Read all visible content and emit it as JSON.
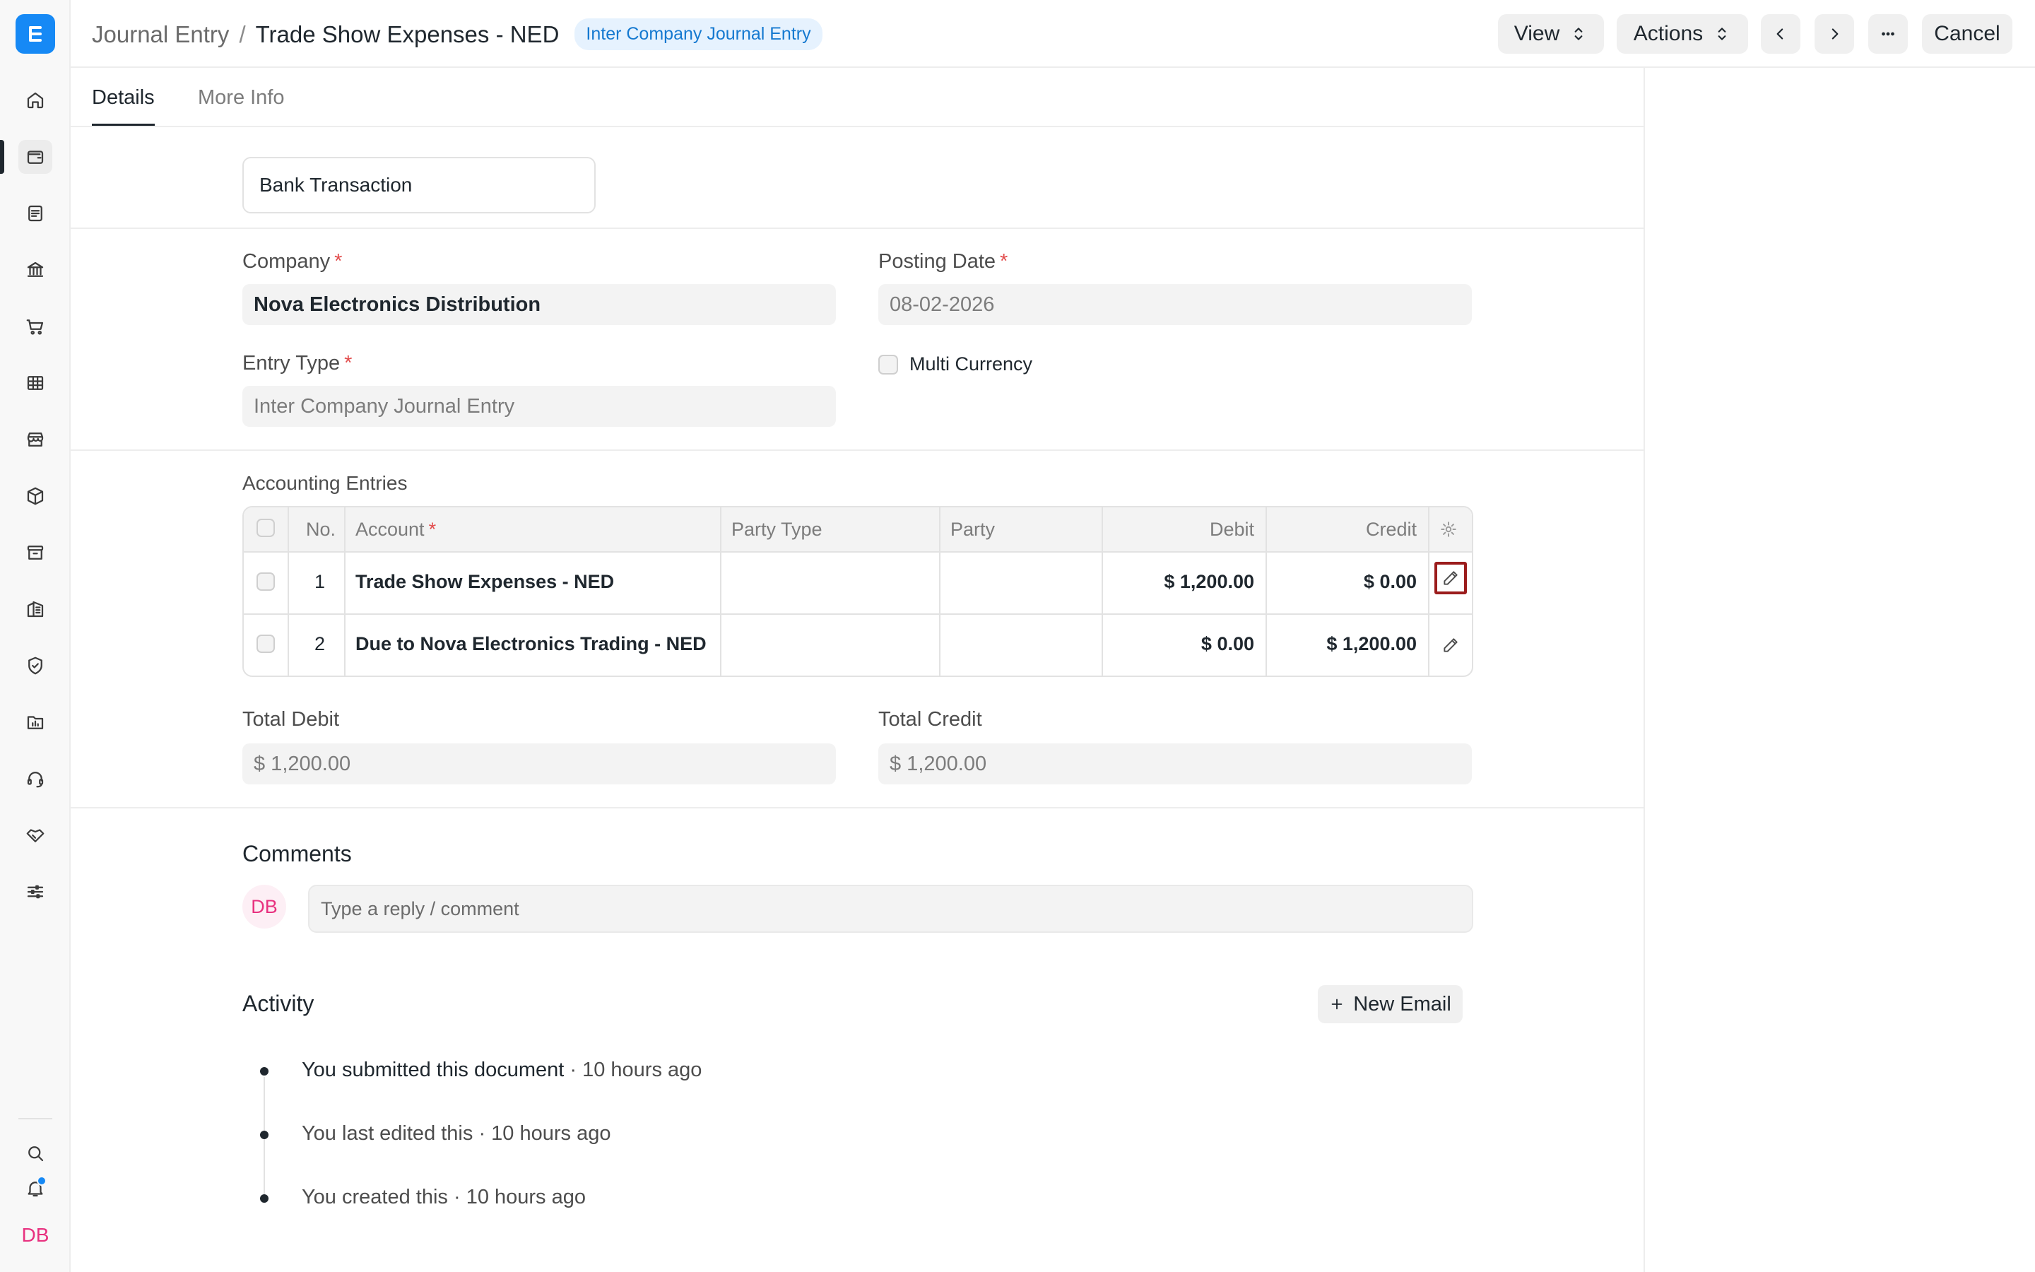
{
  "sidebar": {
    "logo_letter": "E",
    "items": [
      {
        "icon": "home-icon"
      },
      {
        "icon": "accounting-icon",
        "active": true
      },
      {
        "icon": "document-icon"
      },
      {
        "icon": "bank-icon"
      },
      {
        "icon": "cart-icon"
      },
      {
        "icon": "table-icon"
      },
      {
        "icon": "store-icon"
      },
      {
        "icon": "box-icon"
      },
      {
        "icon": "archive-icon"
      },
      {
        "icon": "building-icon"
      },
      {
        "icon": "shield-icon"
      },
      {
        "icon": "folder-chart-icon"
      },
      {
        "icon": "headset-icon"
      },
      {
        "icon": "handshake-icon"
      },
      {
        "icon": "sliders-icon"
      }
    ],
    "bottom": {
      "search_icon": "search-icon",
      "bell_icon": "bell-icon",
      "avatar_initials": "DB"
    }
  },
  "header": {
    "breadcrumb_parent": "Journal Entry",
    "breadcrumb_sep": "/",
    "title": "Trade Show Expenses - NED",
    "status_badge": "Inter Company Journal Entry",
    "view_label": "View",
    "actions_label": "Actions",
    "cancel_label": "Cancel"
  },
  "tabs": [
    {
      "label": "Details",
      "active": true
    },
    {
      "label": "More Info",
      "active": false
    }
  ],
  "form": {
    "bank_transaction": "Bank Transaction",
    "company_label": "Company",
    "company_value": "Nova Electronics Distribution",
    "posting_date_label": "Posting Date",
    "posting_date_value": "08-02-2026",
    "entry_type_label": "Entry Type",
    "entry_type_value": "Inter Company Journal Entry",
    "multi_currency_label": "Multi Currency",
    "required_mark": "*"
  },
  "accounting": {
    "section_label": "Accounting Entries",
    "columns": {
      "no": "No.",
      "account": "Account",
      "party_type": "Party Type",
      "party": "Party",
      "debit": "Debit",
      "credit": "Credit"
    },
    "rows": [
      {
        "no": "1",
        "account": "Trade Show Expenses - NED",
        "party_type": "",
        "party": "",
        "debit": "$ 1,200.00",
        "credit": "$ 0.00"
      },
      {
        "no": "2",
        "account": "Due to Nova Electronics Trading - NED",
        "party_type": "",
        "party": "",
        "debit": "$ 0.00",
        "credit": "$ 1,200.00"
      }
    ]
  },
  "totals": {
    "debit_label": "Total Debit",
    "debit_value": "$ 1,200.00",
    "credit_label": "Total Credit",
    "credit_value": "$ 1,200.00"
  },
  "comments": {
    "heading": "Comments",
    "avatar_initials": "DB",
    "placeholder": "Type a reply / comment"
  },
  "activity": {
    "heading": "Activity",
    "new_email_label": "New Email",
    "items": [
      {
        "text": "You submitted this document",
        "time": " · 10 hours ago"
      },
      {
        "text": "You last edited this",
        "time": " · 10 hours ago"
      },
      {
        "text": "You created this",
        "time": " · 10 hours ago"
      }
    ]
  }
}
